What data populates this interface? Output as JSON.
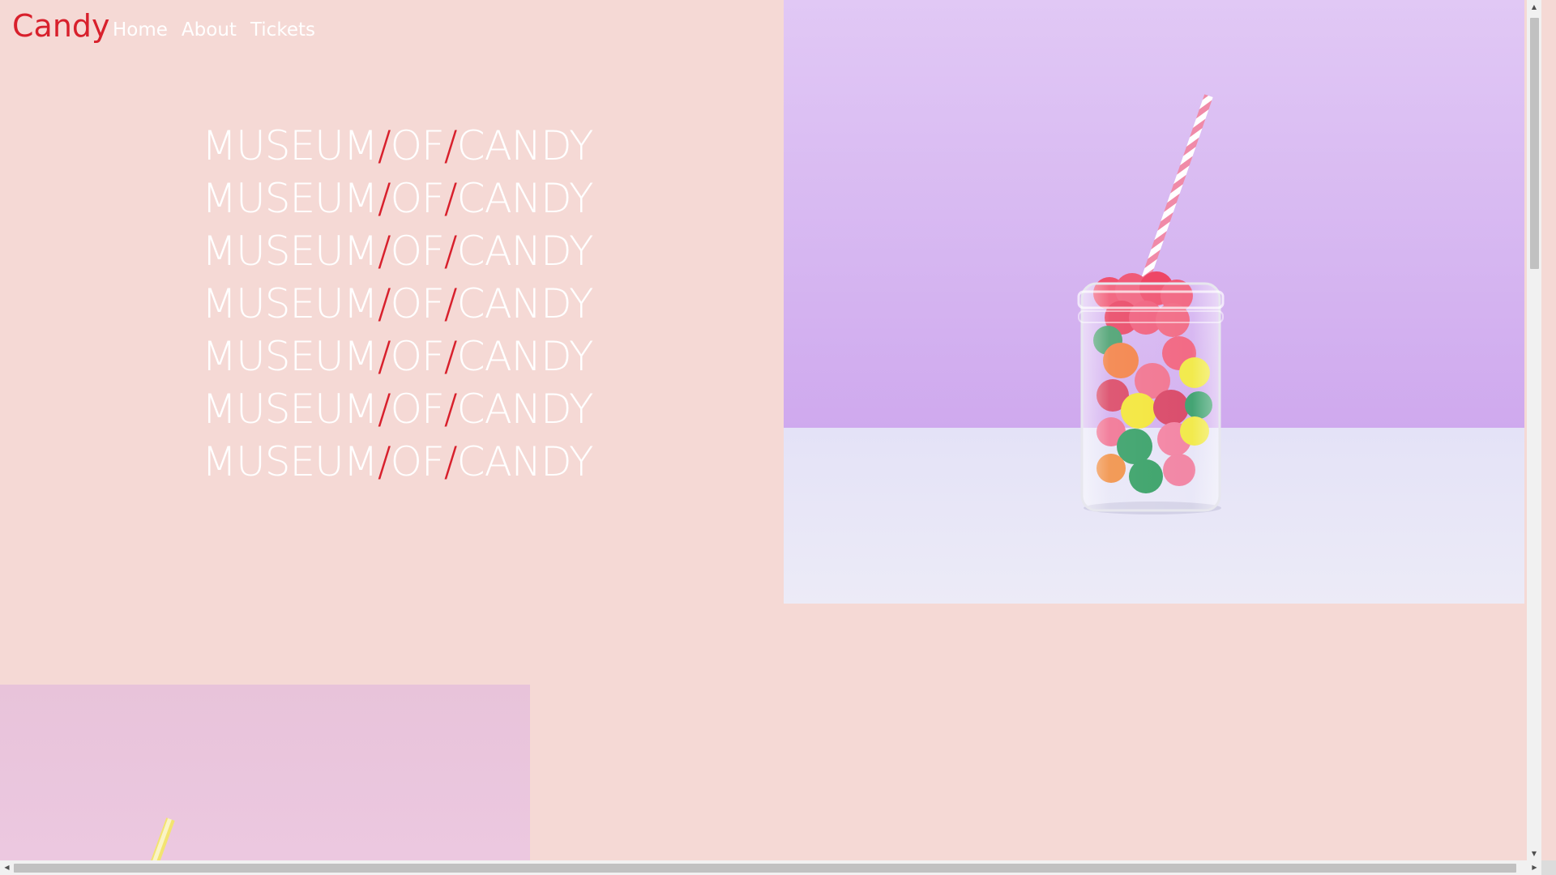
{
  "nav": {
    "brand": "Candy",
    "links": [
      "Home",
      "About",
      "Tickets"
    ]
  },
  "titles": {
    "word1": "MUSEUM",
    "slash": "/",
    "word2": "OF",
    "word3": "CANDY",
    "repeat_count": 7
  },
  "colors": {
    "background": "#f5d9d5",
    "accent": "#d8202c",
    "text": "#ffffff"
  },
  "images": {
    "hero": "candy-jar-with-straw-image",
    "secondary": "pink-background-straw-image"
  },
  "scrollbars": {
    "up_arrow": "▲",
    "down_arrow": "▼",
    "left_arrow": "◀",
    "right_arrow": "▶"
  }
}
